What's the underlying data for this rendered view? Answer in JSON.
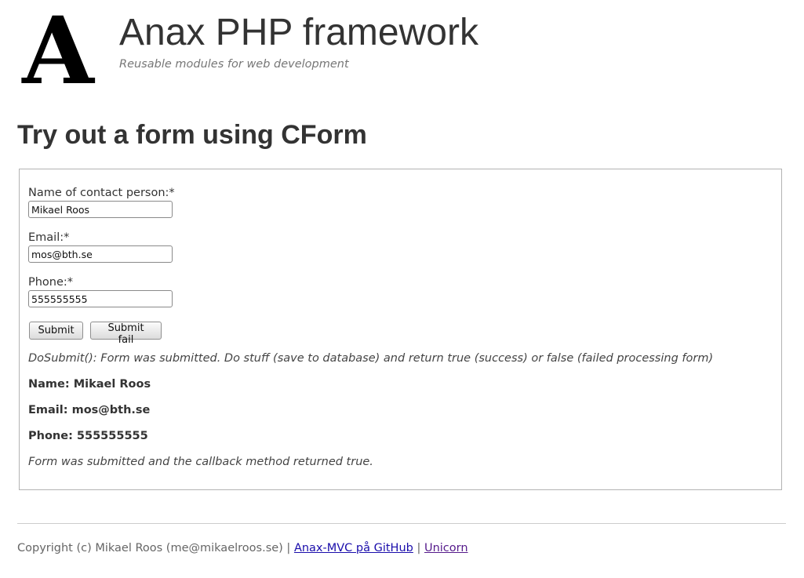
{
  "header": {
    "site_title": "Anax PHP framework",
    "site_slogan": "Reusable modules for web development",
    "logo_letter": "A"
  },
  "main": {
    "heading": "Try out a form using CForm"
  },
  "form": {
    "fields": [
      {
        "label": "Name of contact person:*",
        "value": "Mikael Roos"
      },
      {
        "label": "Email:*",
        "value": "mos@bth.se"
      },
      {
        "label": "Phone:*",
        "value": "555555555"
      }
    ],
    "submit_label": "Submit",
    "submit_fail_label": "Submit fail",
    "result": {
      "dosubmit_message": "DoSubmit(): Form was submitted. Do stuff (save to database) and return true (success) or false (failed processing form)",
      "name_line": "Name: Mikael Roos",
      "email_line": "Email: mos@bth.se",
      "phone_line": "Phone: 555555555",
      "callback_message": "Form was submitted and the callback method returned true."
    }
  },
  "footer": {
    "copyright": "Copyright (c) Mikael Roos (me@mikaelroos.se)",
    "separator": " | ",
    "github_link": "Anax-MVC på GitHub",
    "unicorn_link": "Unicorn"
  },
  "colors": {
    "text": "#333333",
    "slogan": "#777777",
    "link": "#1a0dab",
    "visited_link": "#551a8b",
    "border": "#b3b3b3"
  }
}
